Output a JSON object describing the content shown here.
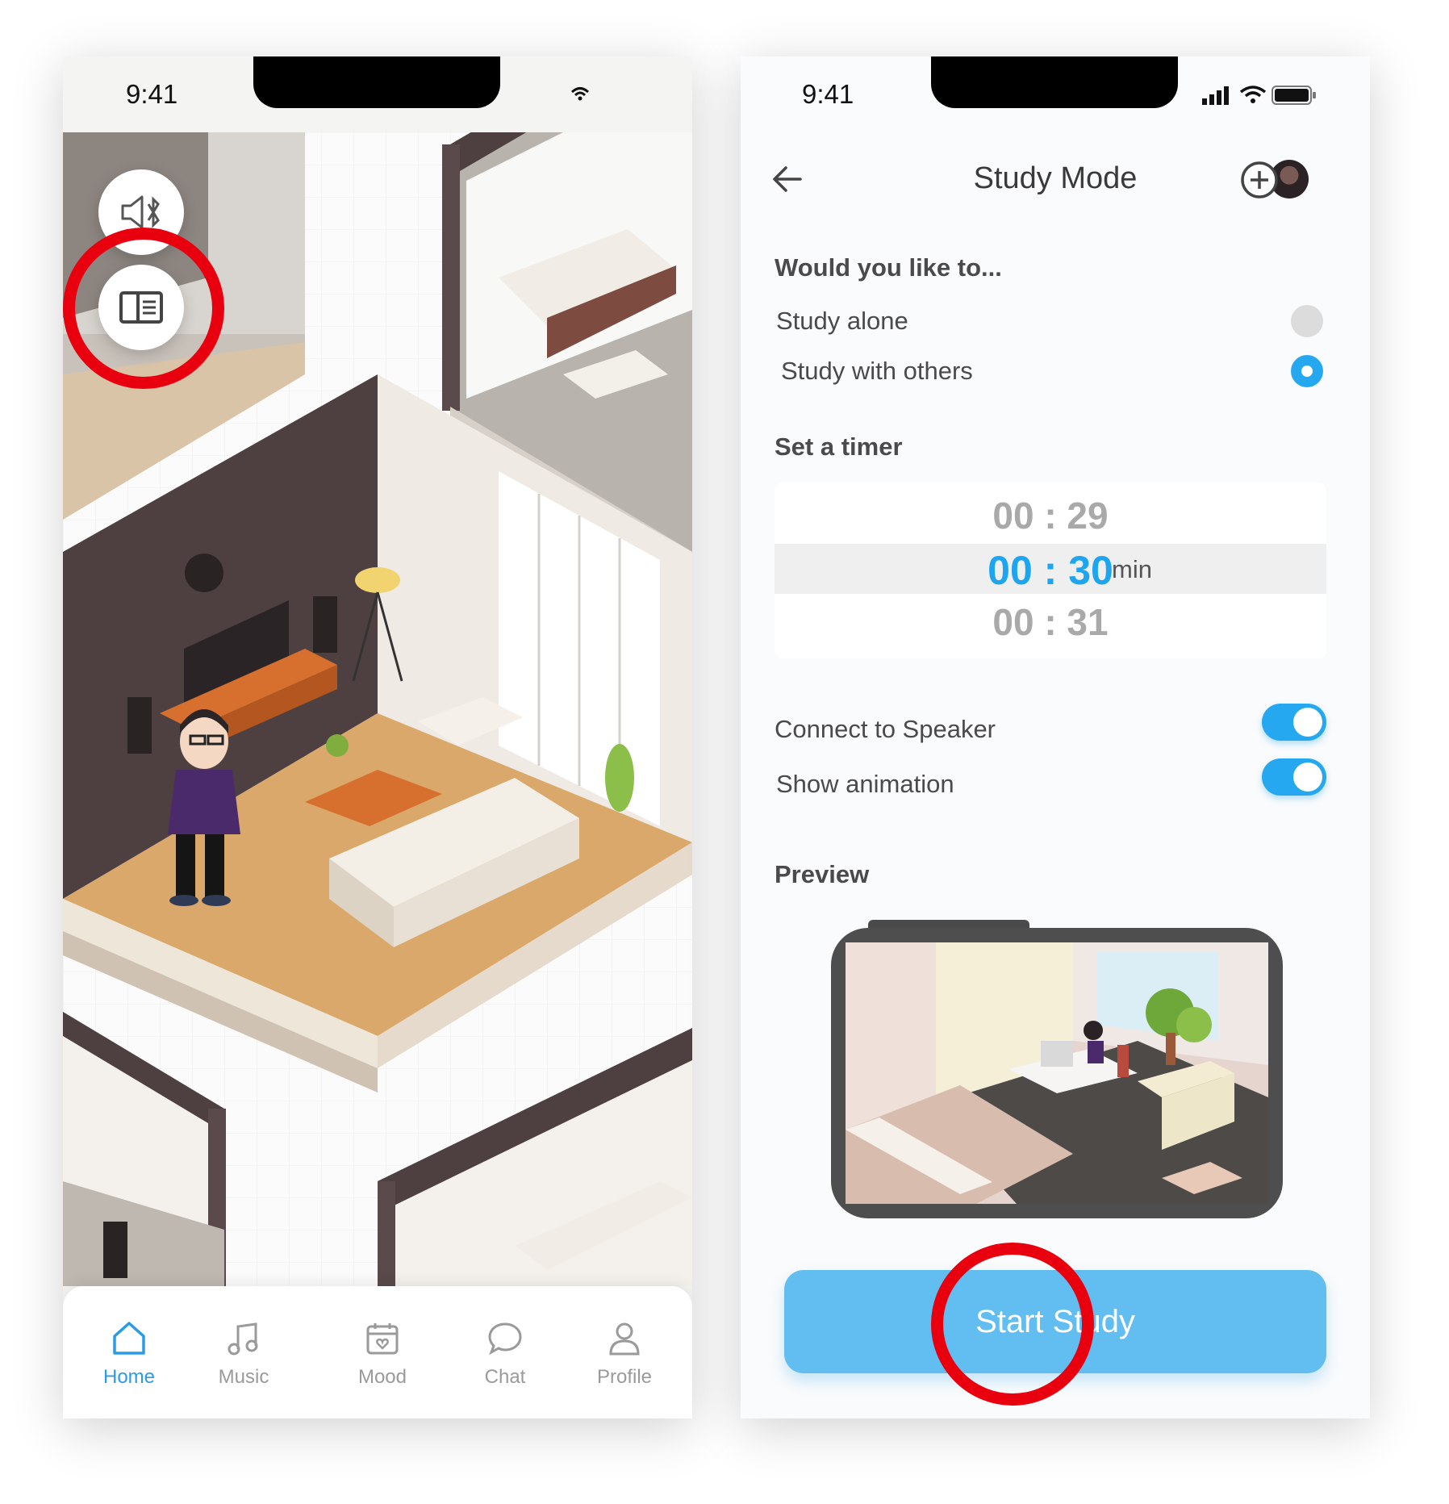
{
  "left_phone": {
    "status_time": "9:41",
    "tabs": [
      {
        "label": "Home",
        "icon": "home-icon",
        "active": true
      },
      {
        "label": "Music",
        "icon": "music-icon",
        "active": false
      },
      {
        "label": "Mood",
        "icon": "calendar-heart-icon",
        "active": false
      },
      {
        "label": "Chat",
        "icon": "chat-bubble-icon",
        "active": false
      },
      {
        "label": "Profile",
        "icon": "person-icon",
        "active": false
      }
    ],
    "floating_buttons": [
      "speaker-bluetooth-icon",
      "book-panel-icon"
    ]
  },
  "right_phone": {
    "status_time": "9:41",
    "title": "Study Mode",
    "question": "Would you like to...",
    "options": [
      {
        "label": "Study alone",
        "selected": false
      },
      {
        "label": "Study with others",
        "selected": true
      }
    ],
    "timer_heading": "Set a timer",
    "timer": {
      "prev": "00 : 29",
      "current": "00 : 30",
      "next": "00 : 31",
      "unit": "min"
    },
    "toggles": [
      {
        "label": "Connect to Speaker",
        "on": true
      },
      {
        "label": "Show animation",
        "on": true
      }
    ],
    "preview_heading": "Preview",
    "start_button": "Start Study"
  },
  "colors": {
    "accent": "#25a8f0",
    "annotation_ring": "#e8000f",
    "button": "#62bdf0"
  }
}
